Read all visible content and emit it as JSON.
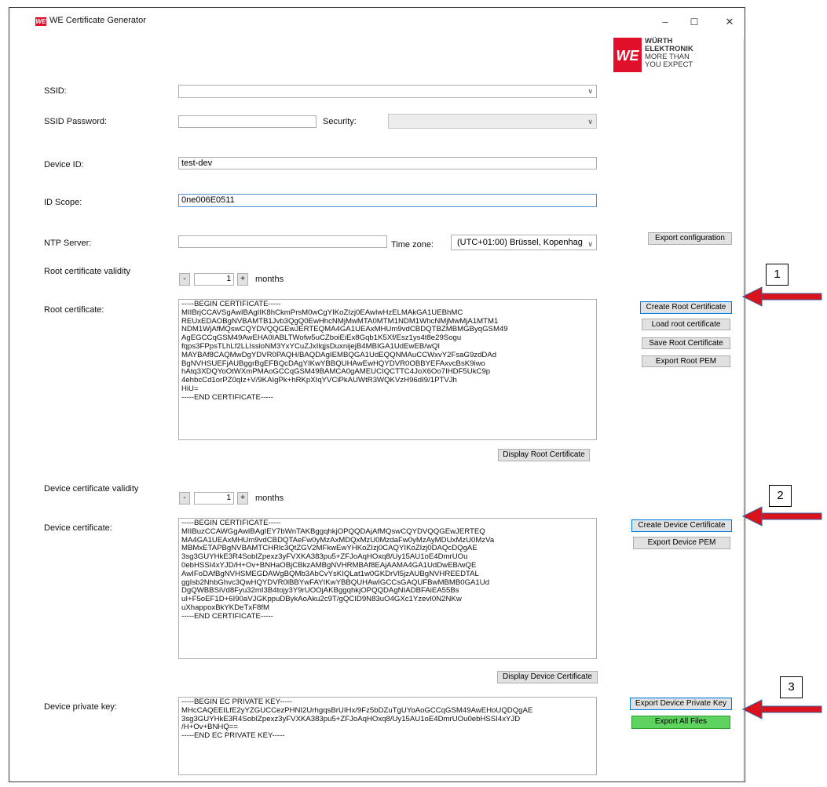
{
  "window": {
    "title": "WE Certificate Generator",
    "logo_letters": "WE",
    "controls": {
      "minimize": "–",
      "maximize": "☐",
      "close": "✕"
    }
  },
  "brand": {
    "logo_letters": "WE",
    "line1": "WÜRTH",
    "line2": "ELEKTRONIK",
    "line3": "MORE THAN",
    "line4": "YOU EXPECT",
    "accent_color": "#e0102a"
  },
  "form": {
    "ssid": {
      "label": "SSID:",
      "value": ""
    },
    "ssid_password": {
      "label": "SSID Password:",
      "value": ""
    },
    "security": {
      "label": "Security:",
      "value": ""
    },
    "device_id": {
      "label": "Device ID:",
      "value": "test-dev"
    },
    "id_scope": {
      "label": "ID Scope:",
      "value": "0ne006E0511"
    },
    "ntp_server": {
      "label": "NTP Server:",
      "value": ""
    },
    "time_zone": {
      "label": "Time zone:",
      "value": "(UTC+01:00) Brüssel, Kopenhag"
    },
    "export_configuration": "Export configuration"
  },
  "root": {
    "validity_label": "Root certificate validity",
    "validity_value": "1",
    "months_label": "months",
    "minus": "-",
    "plus": "+",
    "cert_label": "Root certificate:",
    "cert_text": "-----BEGIN CERTIFICATE-----\nMIIBrjCCAVSgAwIBAgIIK8hCkmPrsM0wCgYIKoZIzj0EAwIwHzELMAkGA1UEBhMC\nREUxEDAOBgNVBAMTB1Jvb3QgQ0EwHhcNMjMwMTA0MTM1NDM1WhcNMjMwMjA1MTM1\nNDM1WjAfMQswCQYDVQQGEwJERTEQMA4GA1UEAxMHUm9vdCBDQTBZMBMGByqGSM49\nAgEGCCqGSM49AwEHA0IABLTWofw5uCZboiEiEx8Gqb1K5Xf/Esz1ys4t8e29Sogu\nfqps3FPpsTLhLf2LLIssloNM3YxYCuZJxIlqjsDuxnijejB4MBIGA1UdEwEB/wQI\nMAYBAf8CAQMwDgYDVR0PAQH/BAQDAgIEMBQGA1UdEQQNMAuCCWxvY2FsaG9zdDAd\nBgNVHSUEFjAUBggrBgEFBQcDAgYIKwYBBQUHAwEwHQYDVR0OBBYEFAxvcBsK9iwo\nhAtq3XDQYoOtWXmPMAoGCCqGSM49BAMCA0gAMEUCIQCTTC4JoX6Oo7IHDF5UkC9p\n4ehbcCd1orPZ0qIz+V/9KAIgPk+hRKpXIqYVCiPkAUWtR3WQKVzH96dI9/1PTVJh\nHiU=\n-----END CERTIFICATE-----",
    "create": "Create Root Certificate",
    "load": "Load root certificate",
    "save": "Save Root Certificate",
    "export_pem": "Export Root PEM",
    "display": "Display Root Certificate"
  },
  "device": {
    "validity_label": "Device certificate validity",
    "validity_value": "1",
    "months_label": "months",
    "minus": "-",
    "plus": "+",
    "cert_label": "Device certificate:",
    "cert_text": "-----BEGIN CERTIFICATE-----\nMIIBuzCCAWGgAwIBAgIEY7bWnTAKBggqhkjOPQQDAjAfMQswCQYDVQQGEwJERTEQ\nMA4GA1UEAxMHUm9vdCBDQTAeFw0yMzAxMDQxMzU0MzdaFw0yMzAyMDUxMzU0MzVa\nMBMxETAPBgNVBAMTCHRlc3QtZGV2MFkwEwYHKoZIzj0CAQYIKoZIzj0DAQcDQgAE\n3sg3GUYHkE3R4SobIZpexz3yFVXKA383pu5+ZFJoAqHOxq8/Uy15AU1oE4DmrUOu\n0ebHSSI4xYJD/H+Ov+BNHaOBjCBkzAMBgNVHRMBAf8EAjAAMA4GA1UdDwEB/wQE\nAwIFoDAfBgNVHSMEGDAWgBQMb3AbCvYsKIQLat1w0GKDrVl5jzAUBgNVHREEDTAL\nggIsb2NhbGhvc3QwHQYDVR0lBBYwFAYIKwYBBQUHAwIGCCsGAQUFBwMBMB0GA1Ud\nDgQWBBSiVd8Fyu32mI3B4tojy3Y9rUOOjAKBggqhkjOPQQDAgNIADBFAiEA55Bs\nuI+F5oEF1D+6I90aVJGKppuDBykAoAku2c9T/gQCID9N83uO4GXc1YzevI0N2NKw\nuXhappoxBkYKDeTxF8fM\n-----END CERTIFICATE-----",
    "create": "Create Device Certificate",
    "export_pem": "Export Device PEM",
    "display": "Display Device Certificate"
  },
  "private_key": {
    "label": "Device private key:",
    "text": "-----BEGIN EC PRIVATE KEY-----\nMHcCAQEEILfE2yYZGUCCezPHNI2UrhgqsBrUIHx/9Fz5bDZuTgUYoAoGCCqGSM49AwEHoUQDQgAE\n3sg3GUYHkE3R4SobIZpexz3yFVXKA383pu5+ZFJoAqHOxq8/Uy15AU1oE4DmrUOu0ebHSSI4xYJD\n/H+Ov+BNHQ==\n-----END EC PRIVATE KEY-----",
    "export": "Export Device Private Key",
    "export_all": "Export All Files"
  },
  "annotations": {
    "box1": "1",
    "box2": "2",
    "box3": "3",
    "arrow_color": "#d8131b"
  }
}
